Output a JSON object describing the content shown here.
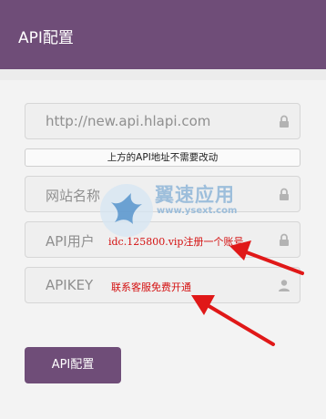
{
  "header": {
    "title": "API配置"
  },
  "fields": [
    {
      "value": "http://new.api.hlapi.com",
      "icon": "lock-icon"
    },
    {
      "value": "网站名称",
      "icon": "lock-icon"
    },
    {
      "value": "API用户",
      "icon": "lock-icon"
    },
    {
      "value": "APIKEY",
      "icon": "user-icon"
    }
  ],
  "note": "上方的API地址不需要改动",
  "annotations": {
    "api_user": "idc.125800.vip注册一个账号",
    "api_key": "联系客服免费开通"
  },
  "watermark": {
    "name": "翼速应用",
    "url": "www.ysext.com"
  },
  "submit_label": "API配置",
  "colors": {
    "header": "#6f4d78",
    "button": "#6f4d78",
    "annotation": "#d41010"
  }
}
